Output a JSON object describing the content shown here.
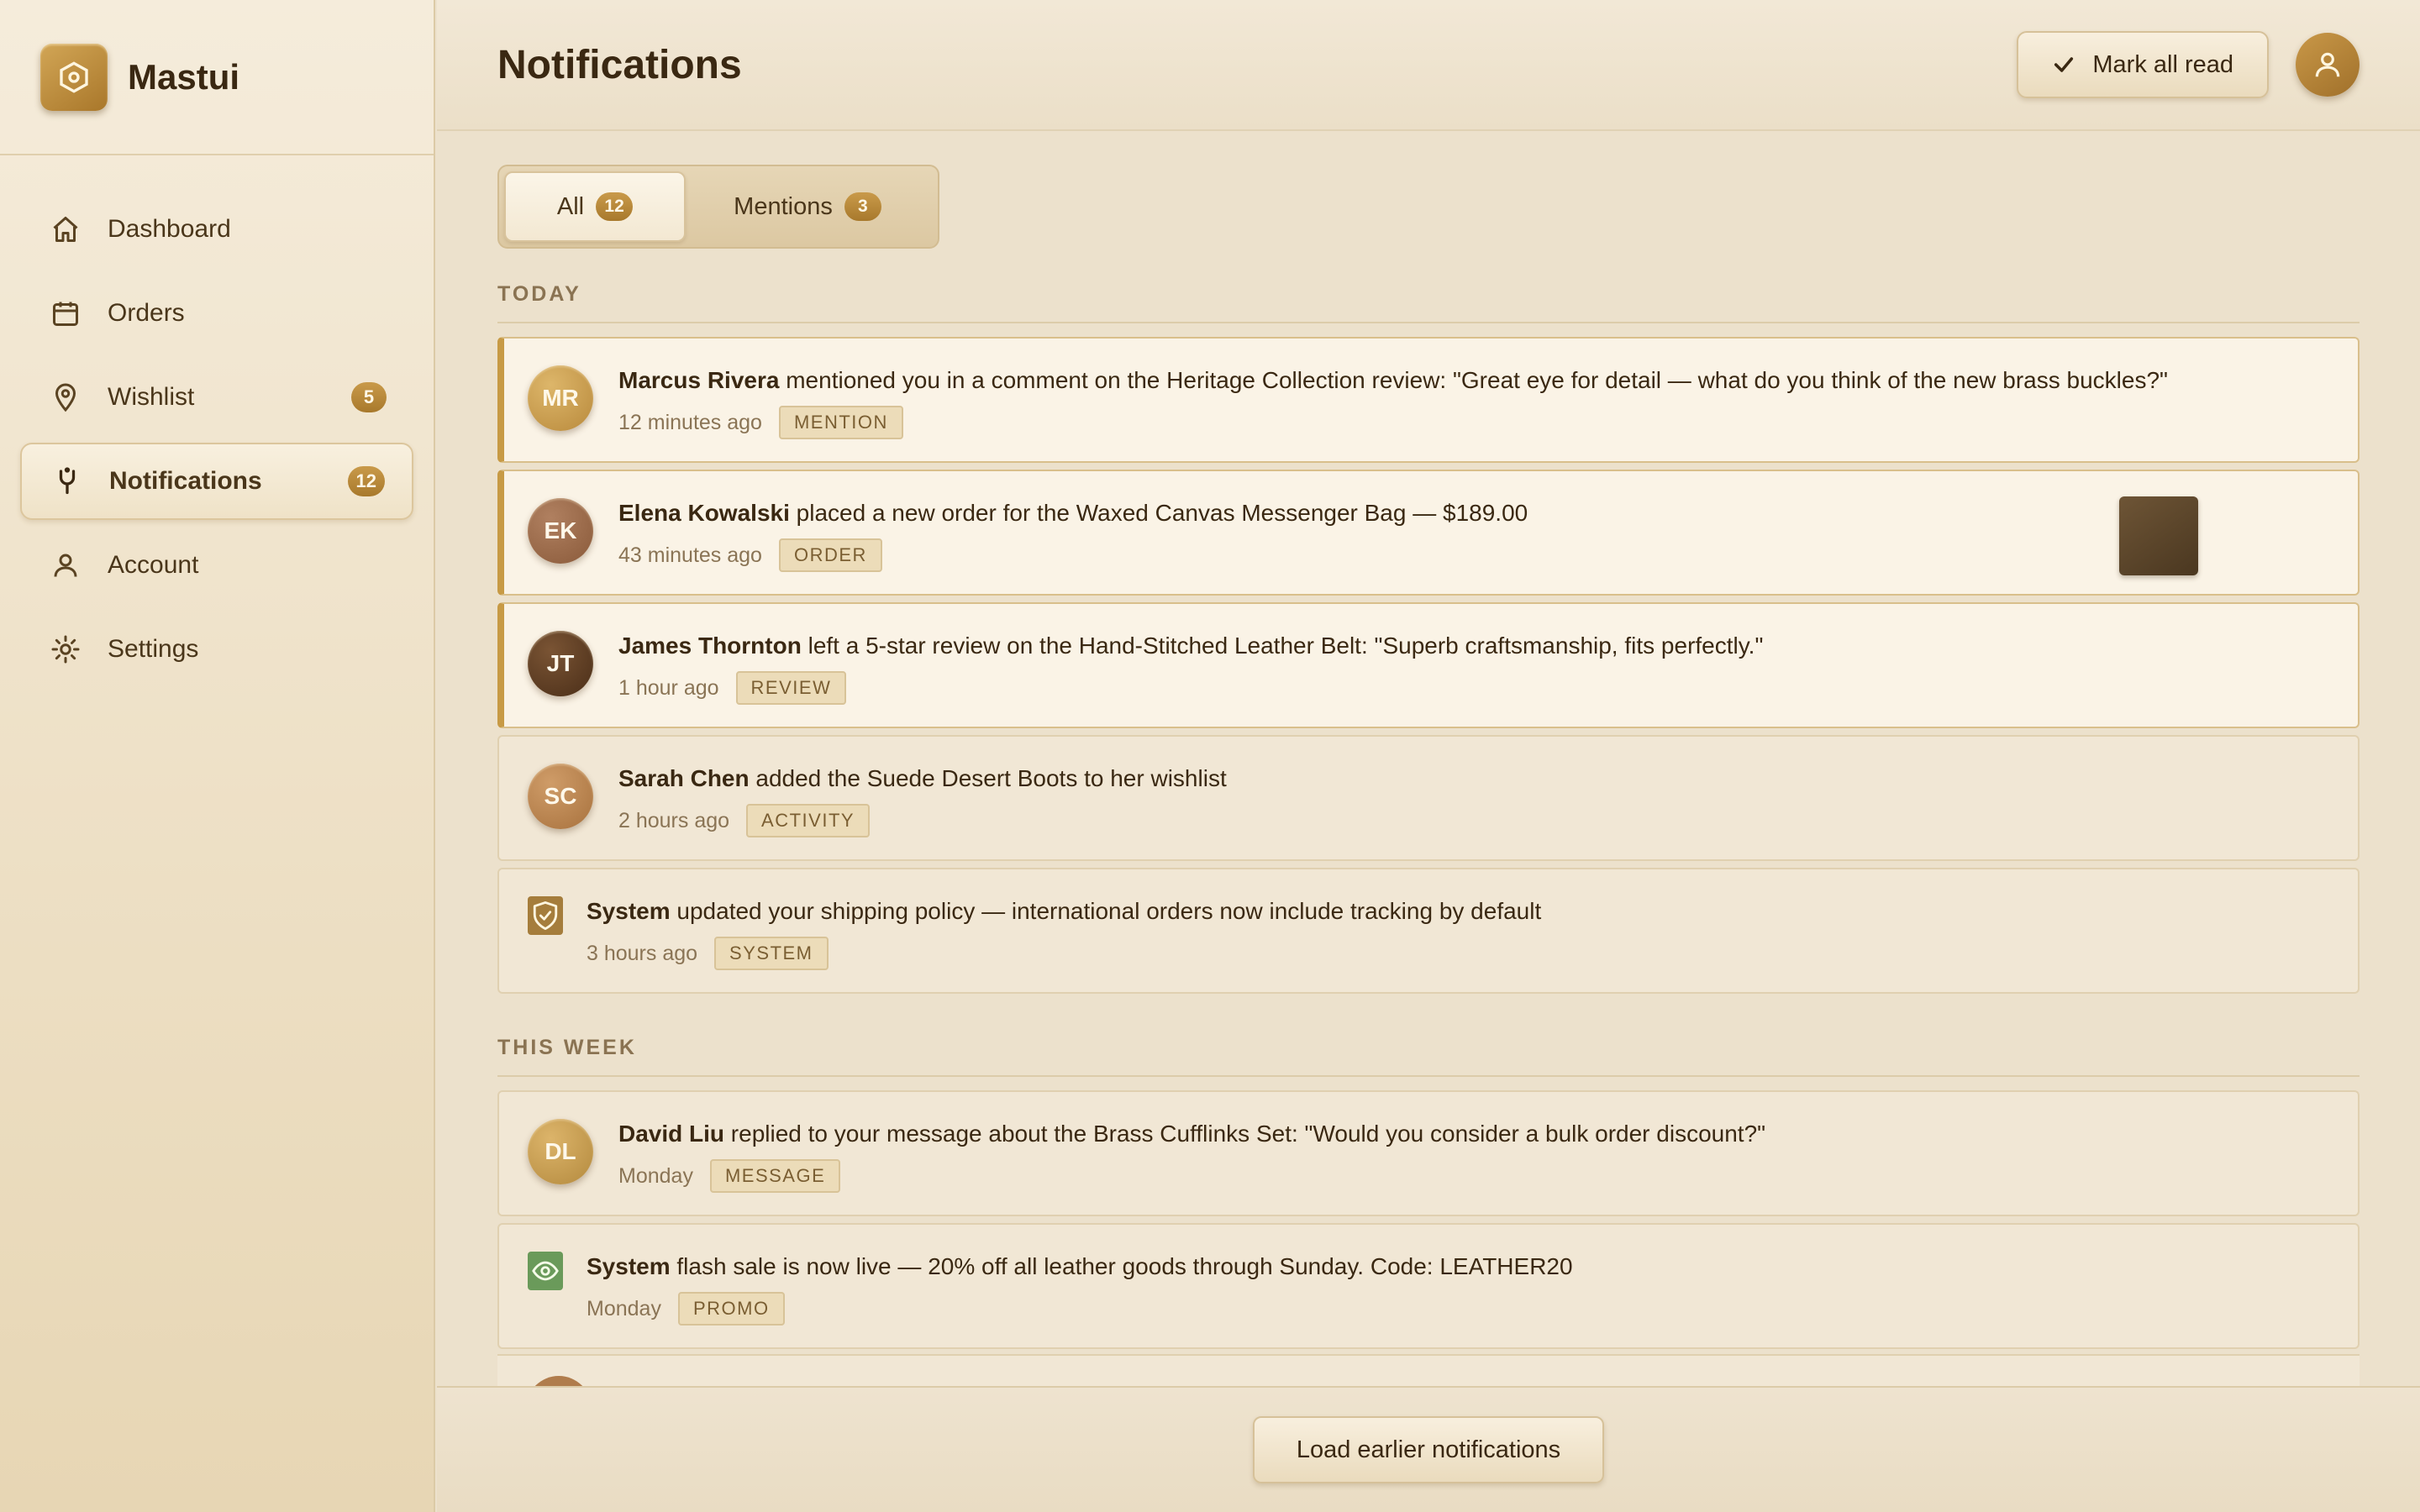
{
  "app": {
    "name": "Mastui"
  },
  "sidebar": {
    "items": [
      {
        "label": "Dashboard",
        "icon": "home-icon"
      },
      {
        "label": "Orders",
        "icon": "calendar-icon"
      },
      {
        "label": "Wishlist",
        "icon": "location-pin-icon",
        "badge": "5"
      },
      {
        "label": "Notifications",
        "icon": "bell-icon",
        "badge": "12",
        "active": true
      },
      {
        "label": "Account",
        "icon": "user-icon"
      },
      {
        "label": "Settings",
        "icon": "gear-icon"
      }
    ]
  },
  "header": {
    "title": "Notifications",
    "mark_all_read_label": "Mark all read"
  },
  "tabs": [
    {
      "label": "All",
      "count": "12",
      "active": true
    },
    {
      "label": "Mentions",
      "count": "3",
      "active": false
    }
  ],
  "sections": {
    "today": "TODAY",
    "this_week": "THIS WEEK"
  },
  "notifications": [
    {
      "initials": "MR",
      "actor": "Marcus Rivera",
      "text": "mentioned you in a comment on the Heritage Collection review: \"Great eye for detail — what do you think of the new brass buckles?\"",
      "time": "12 minutes ago",
      "tag": "MENTION",
      "unread": true,
      "avatar_color": "#c99a4c"
    },
    {
      "initials": "EK",
      "actor": "Elena Kowalski",
      "text": "placed a new order for the Waxed Canvas Messenger Bag — $189.00",
      "time": "43 minutes ago",
      "tag": "ORDER",
      "unread": true,
      "avatar_color": "#9a6a48"
    },
    {
      "initials": "JT",
      "actor": "James Thornton",
      "text": "left a 5-star review on the Hand-Stitched Leather Belt: \"Superb craftsmanship, fits perfectly.\"",
      "time": "1 hour ago",
      "tag": "REVIEW",
      "unread": true,
      "avatar_color": "#5a3a22"
    },
    {
      "initials": "SC",
      "actor": "Sarah Chen",
      "text": "added the Suede Desert Boots to her wishlist",
      "time": "2 hours ago",
      "tag": "ACTIVITY",
      "unread": false,
      "avatar_color": "#b88250"
    },
    {
      "icon": "shield-check-icon",
      "actor": "System",
      "text": "updated your shipping policy — international orders now include tracking by default",
      "time": "3 hours ago",
      "tag": "SYSTEM",
      "unread": false,
      "icon_color": "#a57d3c"
    },
    {
      "initials": "DL",
      "actor": "David Liu",
      "text": "replied to your message about the Brass Cufflinks Set: \"Would you consider a bulk order discount?\"",
      "time": "Monday",
      "tag": "MESSAGE",
      "unread": false,
      "avatar_color": "#c9a050"
    },
    {
      "icon": "eye-tag-icon",
      "actor": "System",
      "text": "flash sale is now live — 20% off all leather goods through Sunday. Code: LEATHER20",
      "time": "Monday",
      "tag": "PROMO",
      "unread": false,
      "icon_color": "#6a9a5a"
    }
  ],
  "footer": {
    "load_more_label": "Load earlier notifications"
  }
}
